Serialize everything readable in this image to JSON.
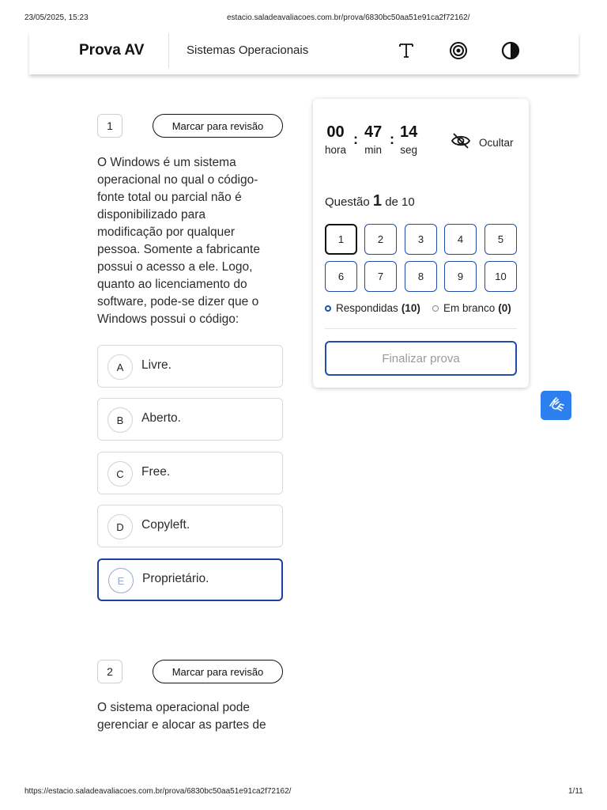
{
  "print": {
    "datetime": "23/05/2025, 15:23",
    "url_top": "estacio.saladeavaliacoes.com.br/prova/6830bc50aa51e91ca2f72162/",
    "url_bottom": "https://estacio.saladeavaliacoes.com.br/prova/6830bc50aa51e91ca2f72162/",
    "page": "1/11"
  },
  "header": {
    "title": "Prova AV",
    "subject": "Sistemas Operacionais",
    "icons": [
      "font-size-icon",
      "target-icon",
      "contrast-icon"
    ]
  },
  "questions": [
    {
      "number": "1",
      "review_label": "Marcar para revisão",
      "lines": [
        "O Windows é um sistema",
        "operacional no qual o código-",
        "fonte total ou parcial não é",
        "disponibilizado para",
        "modificação por qualquer",
        "pessoa. Somente a fabricante",
        "possui o acesso a ele. Logo,",
        "quanto ao licenciamento do",
        "software, pode-se dizer que o",
        "Windows possui o código:"
      ],
      "options": [
        {
          "letter": "A",
          "text": "Livre."
        },
        {
          "letter": "B",
          "text": "Aberto."
        },
        {
          "letter": "C",
          "text": "Free."
        },
        {
          "letter": "D",
          "text": "Copyleft."
        },
        {
          "letter": "E",
          "text": "Proprietário.",
          "selected": true
        }
      ]
    },
    {
      "number": "2",
      "review_label": "Marcar para revisão",
      "lines": [
        "O sistema operacional pode",
        "gerenciar e alocar as partes de"
      ]
    }
  ],
  "timer": {
    "hours": "00",
    "hours_label": "hora",
    "minutes": "47",
    "minutes_label": "min",
    "seconds": "14",
    "seconds_label": "seg",
    "hide_label": "Ocultar"
  },
  "navigator": {
    "prefix": "Questão",
    "current": "1",
    "suffix": "de 10",
    "buttons": [
      "1",
      "2",
      "3",
      "4",
      "5",
      "6",
      "7",
      "8",
      "9",
      "10"
    ],
    "answered_label": "Respondidas",
    "answered_count": "(10)",
    "blank_label": "Em branco",
    "blank_count": "(0)",
    "finish_label": "Finalizar prova"
  },
  "colors": {
    "accent": "#1f4fa8",
    "a11y_button": "#2d7ff0"
  }
}
